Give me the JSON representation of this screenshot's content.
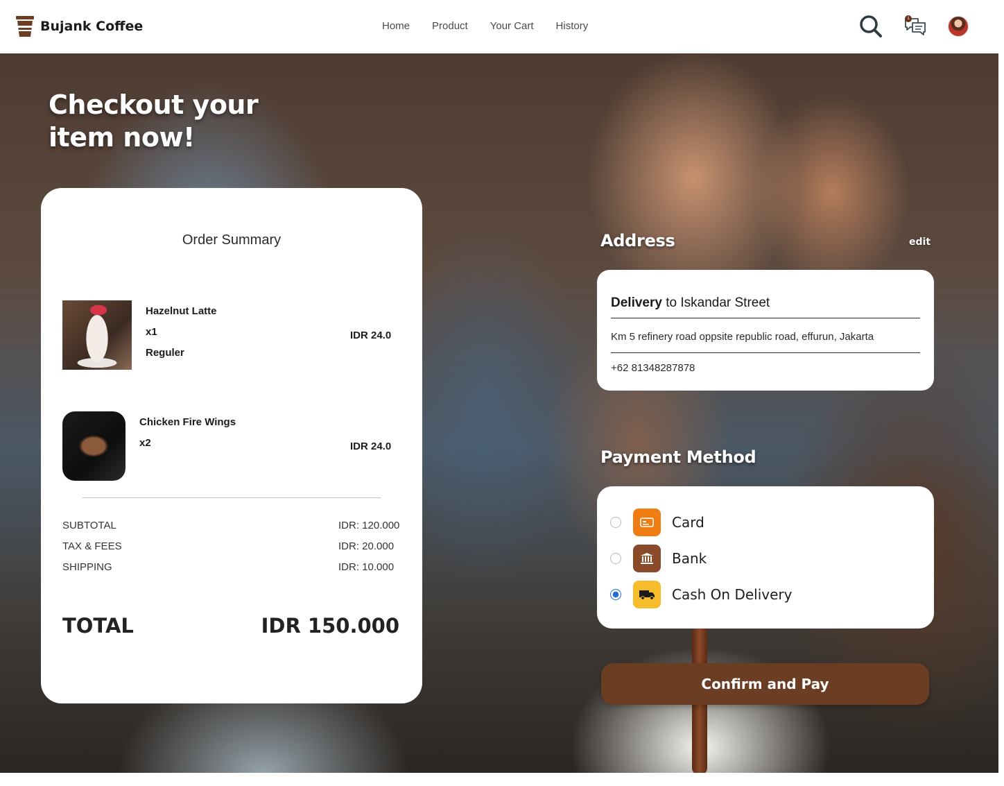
{
  "brand": {
    "name": "Bujank Coffee",
    "icon": "coffee-cup-icon"
  },
  "nav": {
    "links": [
      {
        "label": "Home"
      },
      {
        "label": "Product"
      },
      {
        "label": "Your Cart"
      },
      {
        "label": "History"
      }
    ],
    "chat_badge": "1"
  },
  "hero": {
    "title_line1": "Checkout your",
    "title_line2": "item now!"
  },
  "summary": {
    "heading": "Order Summary",
    "items": [
      {
        "name": "Hazelnut Latte",
        "qty": "x1",
        "variant": "Reguler",
        "price": "IDR 24.0"
      },
      {
        "name": "Chicken Fire Wings",
        "qty": "x2",
        "price": "IDR 24.0"
      }
    ],
    "fees": [
      {
        "label": "SUBTOTAL",
        "value": "IDR: 120.000"
      },
      {
        "label": "TAX & FEES",
        "value": "IDR: 20.000"
      },
      {
        "label": "SHIPPING",
        "value": "IDR: 10.000"
      }
    ],
    "total_label": "TOTAL",
    "total_value": "IDR 150.000"
  },
  "address": {
    "heading": "Address",
    "edit_label": "edit",
    "title_bold": "Delivery",
    "title_rest": " to Iskandar Street",
    "street": "Km 5 refinery road oppsite republic road, effurun, Jakarta",
    "phone": "+62 81348287878"
  },
  "payment": {
    "heading": "Payment Method",
    "options": [
      {
        "label": "Card",
        "icon": "card-icon",
        "color": "#f07d12",
        "selected": false
      },
      {
        "label": "Bank",
        "icon": "bank-icon",
        "color": "#8a4b2a",
        "selected": false
      },
      {
        "label": "Cash On Delivery",
        "icon": "truck-icon",
        "color": "#f7bc2c",
        "selected": true
      }
    ]
  },
  "confirm_label": "Confirm and Pay",
  "colors": {
    "accent": "#6b3d23",
    "radio": "#1f6fd0"
  }
}
